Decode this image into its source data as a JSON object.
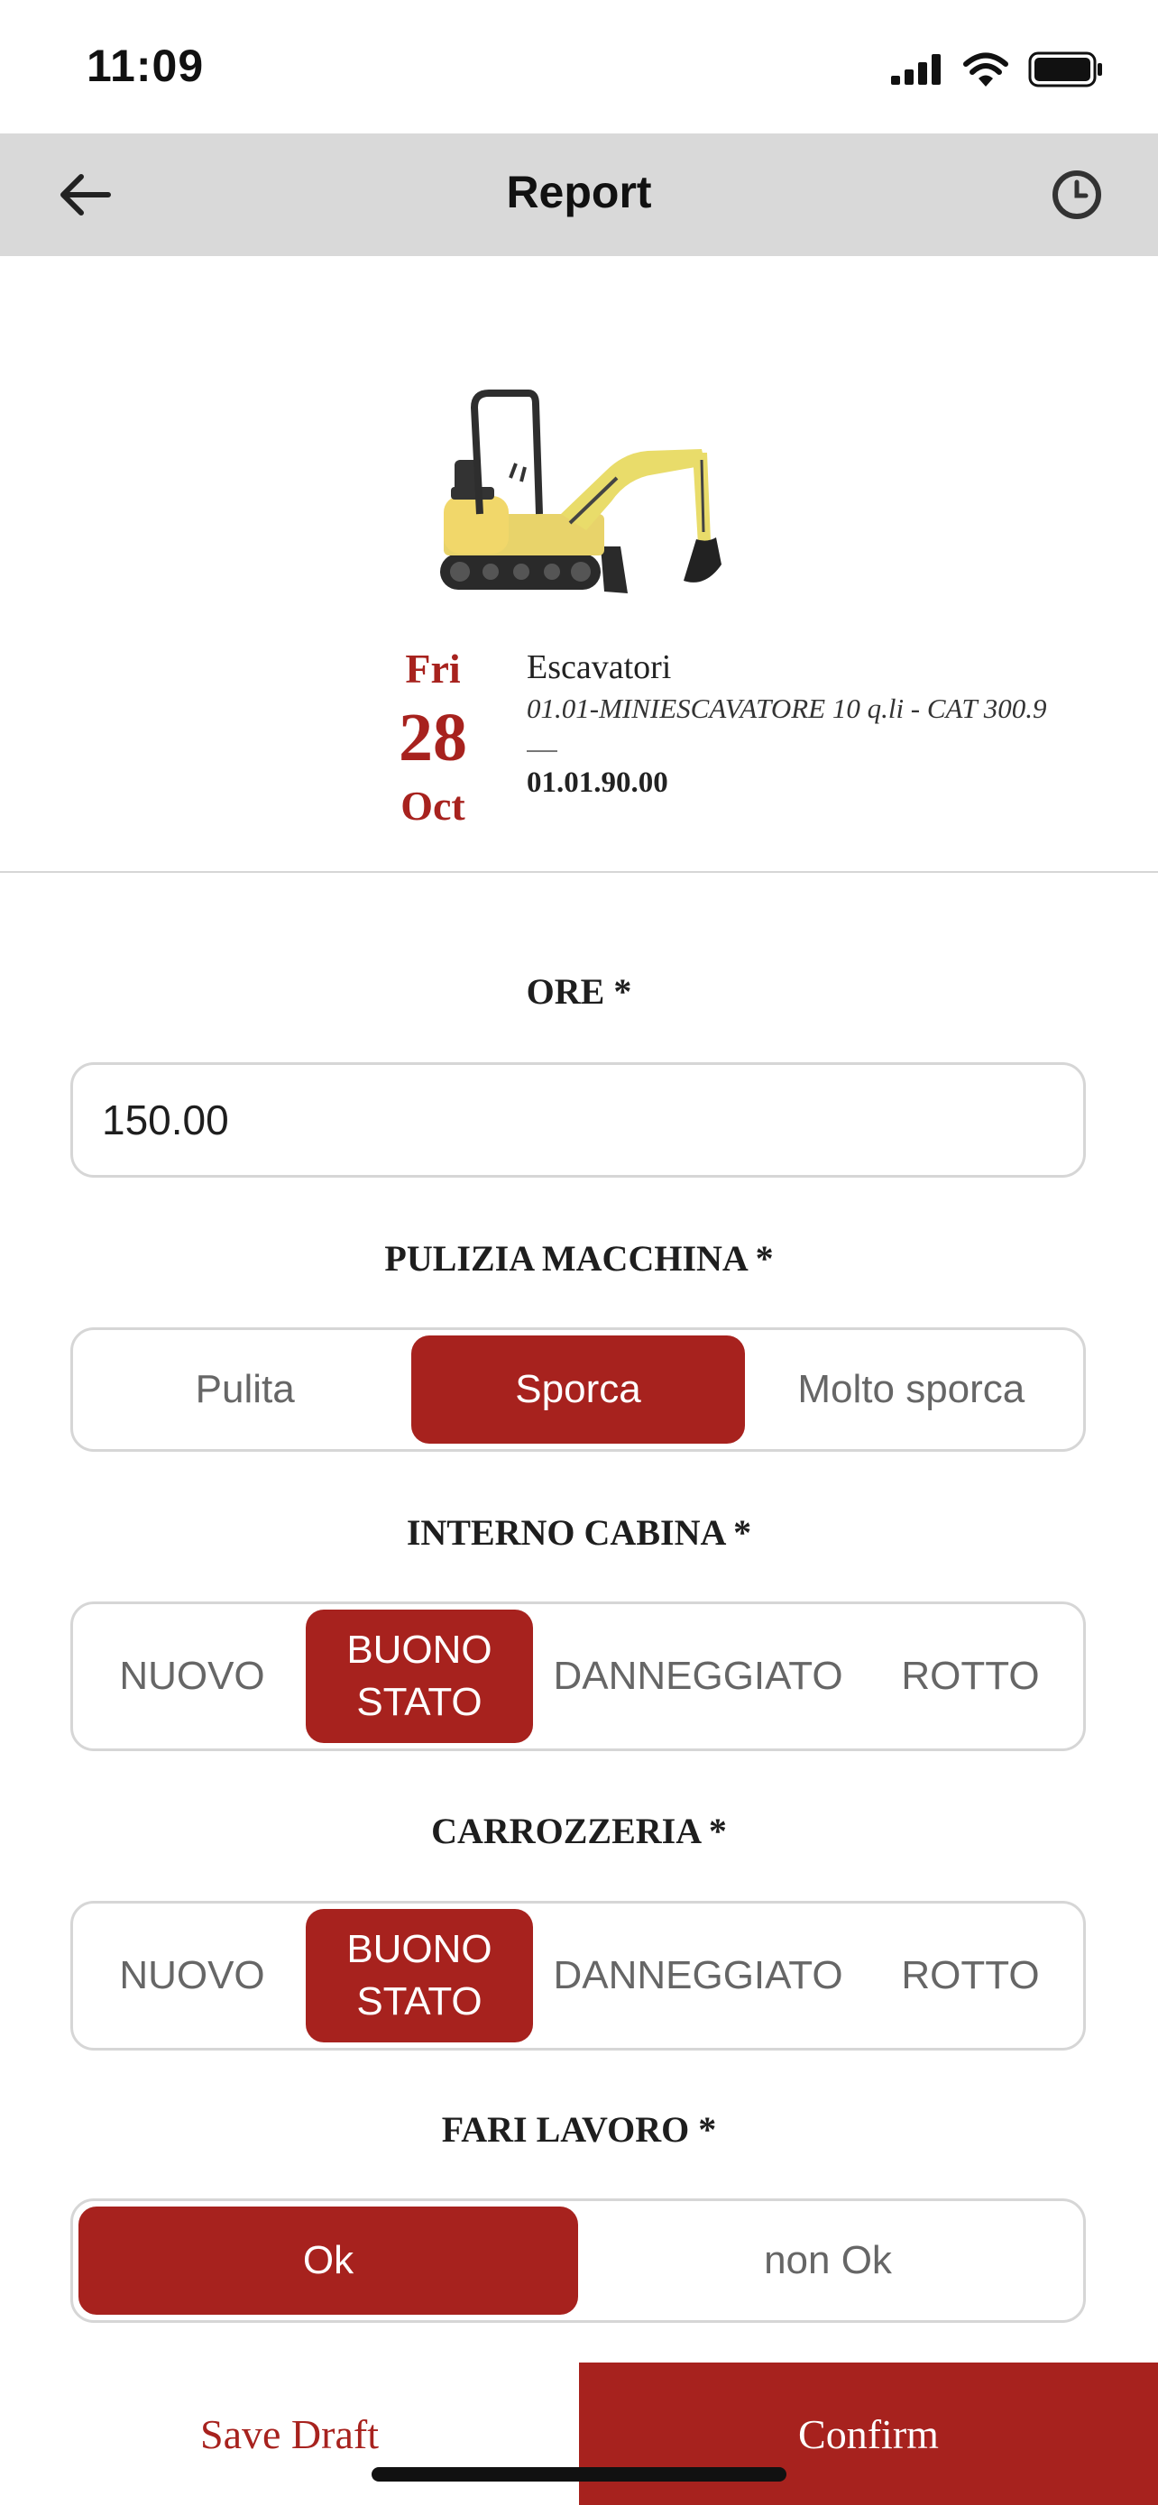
{
  "status_bar": {
    "time": "11:09"
  },
  "nav": {
    "title": "Report",
    "back_icon": "arrow-left-icon",
    "history_icon": "clock-icon"
  },
  "machine": {
    "date": {
      "weekday": "Fri",
      "day": "28",
      "month": "Oct"
    },
    "category": "Escavatori",
    "model": "01.01-MINIESCAVATORE 10 q.li - CAT 300.9",
    "code": "01.01.90.00",
    "image": "mini-excavator"
  },
  "form": {
    "ore": {
      "label": "ORE *",
      "value": "150.00"
    },
    "pulizia": {
      "label": "PULIZIA MACCHINA *",
      "options": [
        "Pulita",
        "Sporca",
        "Molto sporca"
      ],
      "selected": "Sporca"
    },
    "interno": {
      "label": "INTERNO CABINA *",
      "options": [
        "NUOVO",
        "BUONO STATO",
        "DANNEGGIATO",
        "ROTTO"
      ],
      "selected": "BUONO STATO"
    },
    "carrozzeria": {
      "label": "CARROZZERIA *",
      "options": [
        "NUOVO",
        "BUONO STATO",
        "DANNEGGIATO",
        "ROTTO"
      ],
      "selected": "BUONO STATO"
    },
    "fari": {
      "label": "FARI LAVORO *",
      "options": [
        "Ok",
        "non Ok"
      ],
      "selected": "Ok"
    }
  },
  "footer": {
    "save_draft": "Save Draft",
    "confirm": "Confirm"
  },
  "colors": {
    "accent": "#a7221e",
    "nav_bg": "#d9d9d9",
    "border": "#d6d6d6"
  }
}
